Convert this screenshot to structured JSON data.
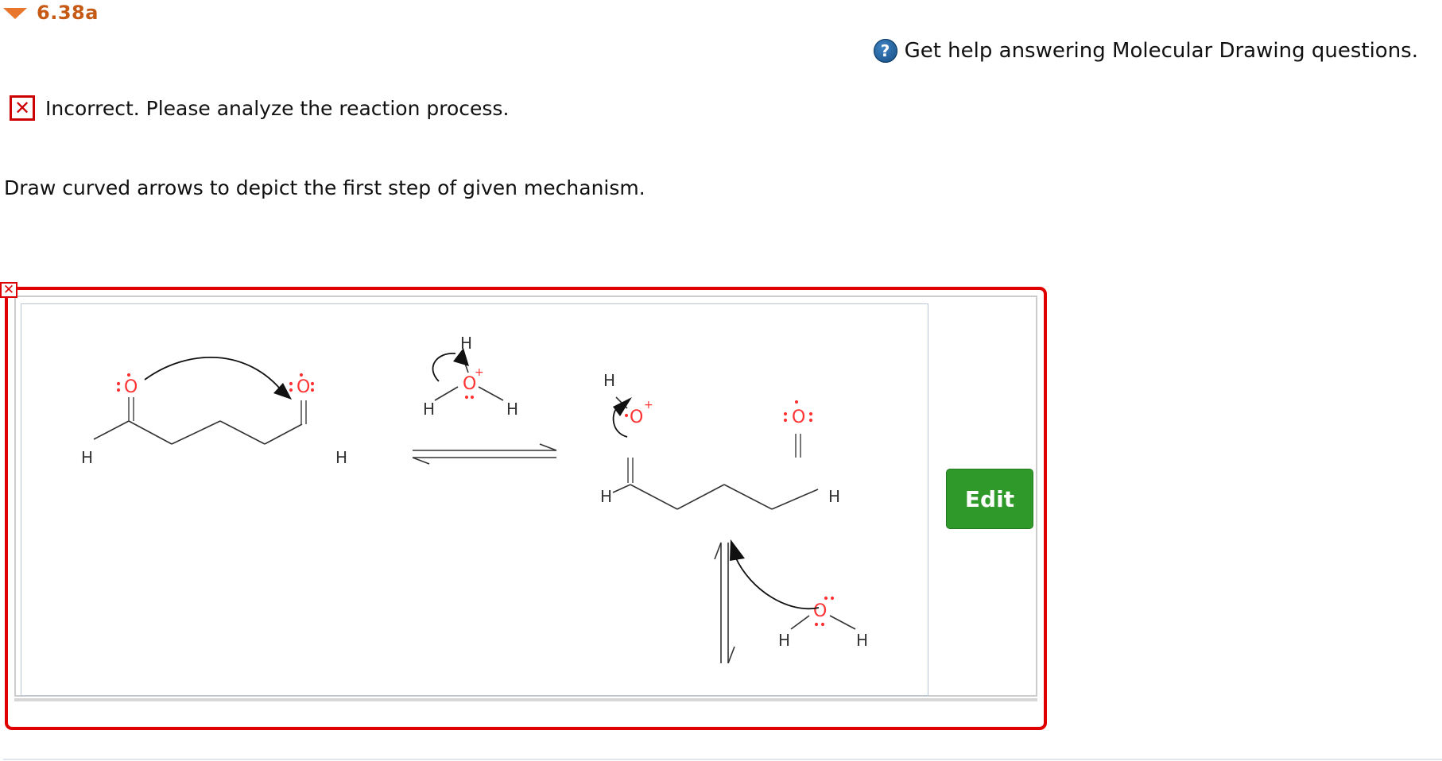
{
  "question": {
    "number": "6.38a",
    "help_text": "Get help answering Molecular Drawing questions.",
    "help_icon": "?",
    "feedback_icon": "✕",
    "feedback_text": "Incorrect. Please analyze the reaction process.",
    "instructions": "Draw curved arrows to depict the first step of given mechanism."
  },
  "answer": {
    "error_marker": "✕",
    "edit_label": "Edit",
    "molecule_labels": {
      "hydrogen": "H",
      "oxygen": "O",
      "plus": "+"
    }
  },
  "colors": {
    "accent_orange": "#e8762d",
    "error_red": "#e00000",
    "edit_green": "#2f9a2a",
    "oxygen_red": "#ff3333"
  }
}
